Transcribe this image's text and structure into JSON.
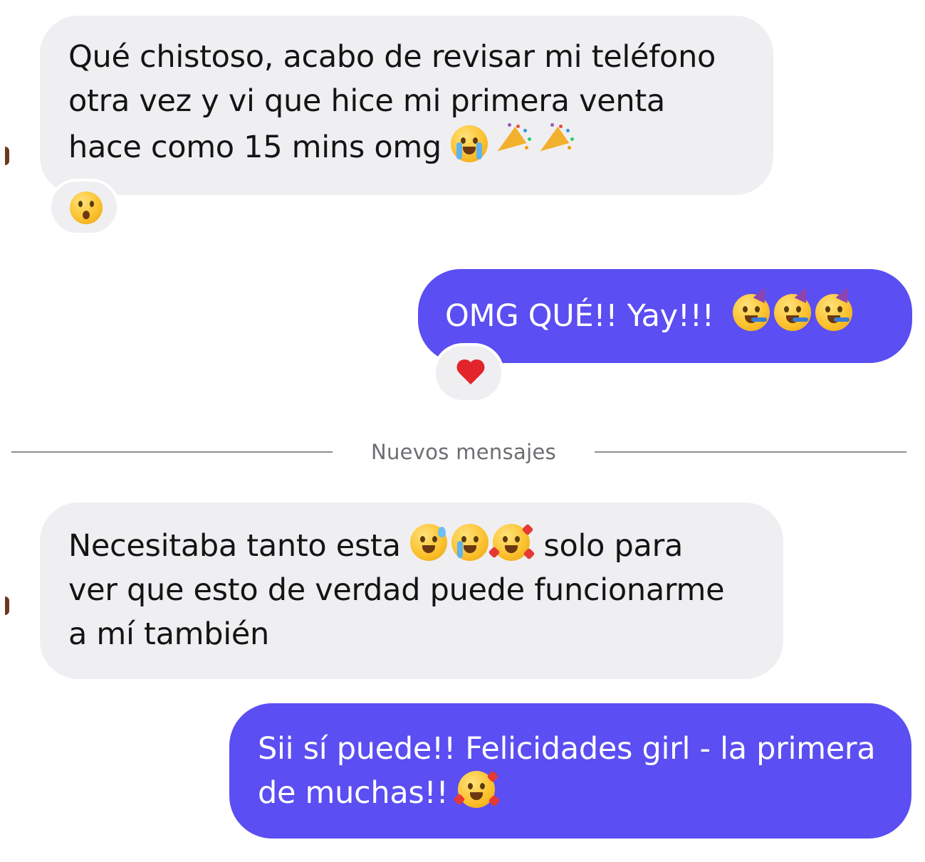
{
  "messages": [
    {
      "sender": "them",
      "lines": [
        "Qué chistoso, acabo de revisar mi teléfono",
        "otra vez y vi que hice mi primera venta",
        "hace como 15 mins omg"
      ],
      "emojis": [
        "loudly-crying-face-emoji",
        "party-popper-emoji",
        "party-popper-emoji"
      ],
      "reaction": "hushed-face-emoji"
    },
    {
      "sender": "me",
      "lines": [
        "OMG QUÉ!! Yay!!!"
      ],
      "emojis": [
        "partying-face-emoji",
        "partying-face-emoji",
        "partying-face-emoji"
      ],
      "reaction": "red-heart-emoji"
    },
    {
      "sender": "them",
      "lines": [
        "Necesitaba tanto esta",
        "solo para",
        "ver que esto de verdad puede funcionarme",
        "a mí también"
      ],
      "emojis": [
        "grinning-sweat-face-emoji",
        "sad-relieved-face-emoji",
        "smiling-face-with-hearts-emoji"
      ]
    },
    {
      "sender": "me",
      "lines": [
        "Sii sí puede!! Felicidades girl - la primera",
        "de muchas!!"
      ],
      "emojis": [
        "smiling-face-with-hearts-emoji"
      ]
    }
  ],
  "divider": {
    "label": "Nuevos mensajes"
  },
  "colors": {
    "incoming_bubble": "#efeff2",
    "outgoing_bubble": "#5b4ef2",
    "outgoing_text": "#ffffff",
    "divider_text": "#6d6d72"
  }
}
